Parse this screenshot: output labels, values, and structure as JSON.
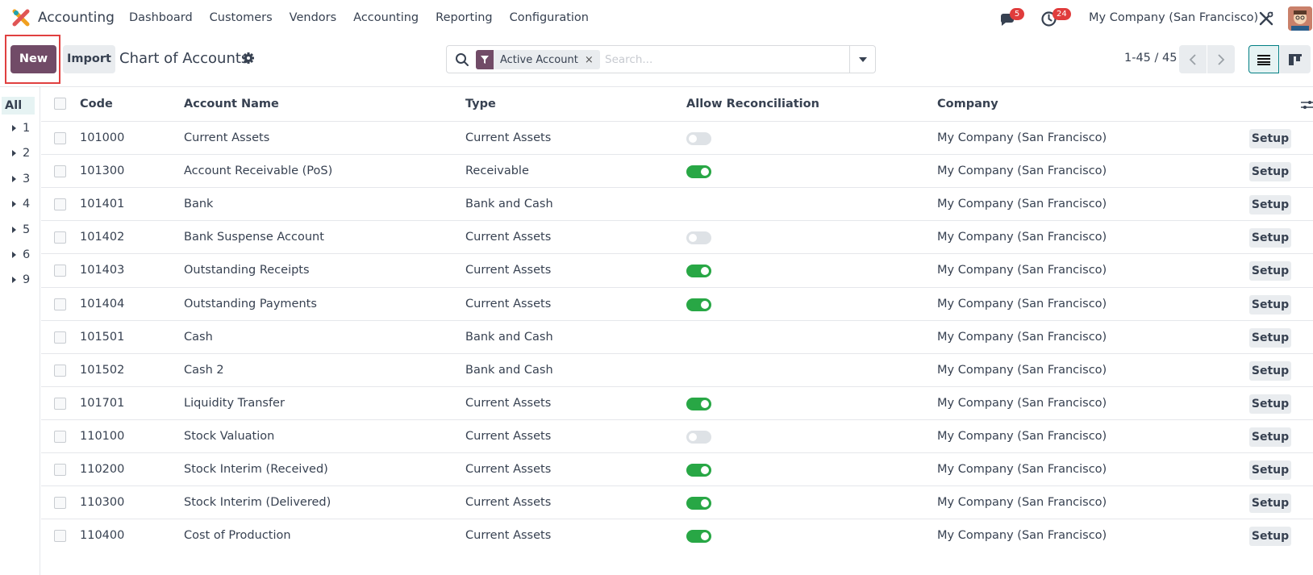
{
  "navbar": {
    "app_name": "Accounting",
    "menu": [
      "Dashboard",
      "Customers",
      "Vendors",
      "Accounting",
      "Reporting",
      "Configuration"
    ],
    "messages_count": "5",
    "activities_count": "24",
    "company": "My Company (San Francisco)"
  },
  "control_panel": {
    "new_label": "New",
    "import_label": "Import",
    "title": "Chart of Accounts",
    "search": {
      "facet_label": "Active Account",
      "facet_remove": "×",
      "placeholder": "Search..."
    },
    "pager": "1-45 / 45"
  },
  "search_panel": {
    "all_label": "All",
    "groups": [
      "1",
      "2",
      "3",
      "4",
      "5",
      "6",
      "9"
    ]
  },
  "table": {
    "headers": {
      "code": "Code",
      "name": "Account Name",
      "type": "Type",
      "reconcile": "Allow Reconciliation",
      "company": "Company"
    },
    "rows": [
      {
        "code": "101000",
        "name": "Current Assets",
        "type": "Current Assets",
        "reconcile": "off",
        "company": "My Company (San Francisco)",
        "action": "Setup"
      },
      {
        "code": "101300",
        "name": "Account Receivable (PoS)",
        "type": "Receivable",
        "reconcile": "on",
        "company": "My Company (San Francisco)",
        "action": "Setup"
      },
      {
        "code": "101401",
        "name": "Bank",
        "type": "Bank and Cash",
        "reconcile": "none",
        "company": "My Company (San Francisco)",
        "action": "Setup"
      },
      {
        "code": "101402",
        "name": "Bank Suspense Account",
        "type": "Current Assets",
        "reconcile": "off",
        "company": "My Company (San Francisco)",
        "action": "Setup"
      },
      {
        "code": "101403",
        "name": "Outstanding Receipts",
        "type": "Current Assets",
        "reconcile": "on",
        "company": "My Company (San Francisco)",
        "action": "Setup"
      },
      {
        "code": "101404",
        "name": "Outstanding Payments",
        "type": "Current Assets",
        "reconcile": "on",
        "company": "My Company (San Francisco)",
        "action": "Setup"
      },
      {
        "code": "101501",
        "name": "Cash",
        "type": "Bank and Cash",
        "reconcile": "none",
        "company": "My Company (San Francisco)",
        "action": "Setup"
      },
      {
        "code": "101502",
        "name": "Cash 2",
        "type": "Bank and Cash",
        "reconcile": "none",
        "company": "My Company (San Francisco)",
        "action": "Setup"
      },
      {
        "code": "101701",
        "name": "Liquidity Transfer",
        "type": "Current Assets",
        "reconcile": "on",
        "company": "My Company (San Francisco)",
        "action": "Setup"
      },
      {
        "code": "110100",
        "name": "Stock Valuation",
        "type": "Current Assets",
        "reconcile": "off",
        "company": "My Company (San Francisco)",
        "action": "Setup"
      },
      {
        "code": "110200",
        "name": "Stock Interim (Received)",
        "type": "Current Assets",
        "reconcile": "on",
        "company": "My Company (San Francisco)",
        "action": "Setup"
      },
      {
        "code": "110300",
        "name": "Stock Interim (Delivered)",
        "type": "Current Assets",
        "reconcile": "on",
        "company": "My Company (San Francisco)",
        "action": "Setup"
      },
      {
        "code": "110400",
        "name": "Cost of Production",
        "type": "Current Assets",
        "reconcile": "on",
        "company": "My Company (San Francisco)",
        "action": "Setup"
      }
    ]
  },
  "colors": {
    "brand": "#714b67",
    "toggle_on": "#28a745",
    "badge": "#e03c3c",
    "highlight": "#e04040"
  },
  "icons": [
    "app-logo-icon",
    "chat-icon",
    "clock-icon",
    "tools-icon",
    "gear-icon",
    "search-icon",
    "filter-icon",
    "chevron-left-icon",
    "chevron-right-icon",
    "list-view-icon",
    "kanban-view-icon",
    "column-options-icon"
  ]
}
